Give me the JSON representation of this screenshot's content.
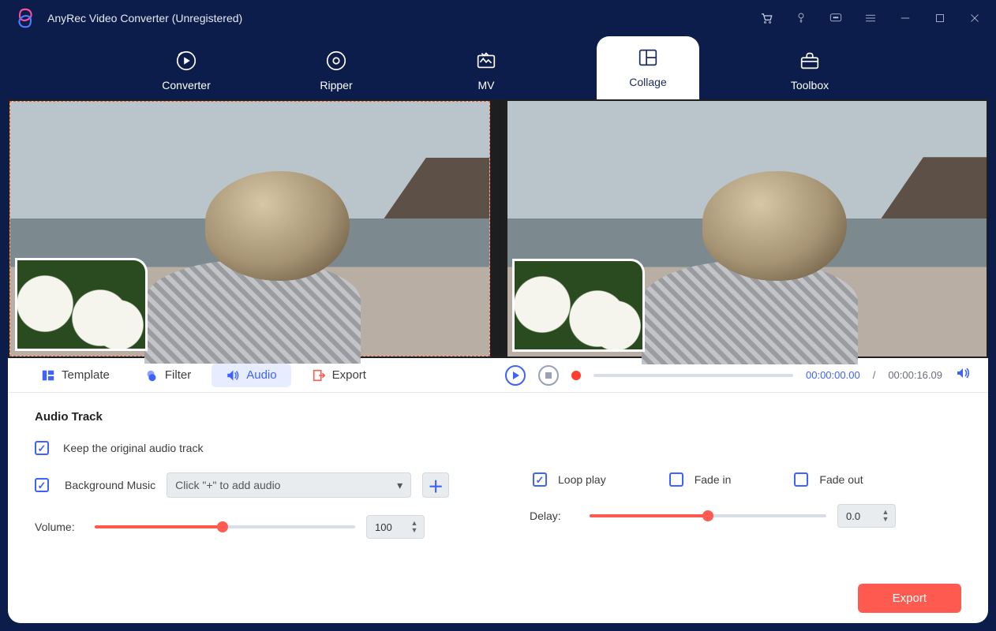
{
  "window": {
    "title": "AnyRec Video Converter (Unregistered)"
  },
  "colors": {
    "accent_blue": "#3d62ff",
    "accent_orange": "#ff5a4f",
    "header_bg": "#0c1d4c"
  },
  "mainnav": {
    "items": [
      {
        "label": "Converter",
        "icon": "converter-icon",
        "active": false
      },
      {
        "label": "Ripper",
        "icon": "ripper-icon",
        "active": false
      },
      {
        "label": "MV",
        "icon": "mv-icon",
        "active": false
      },
      {
        "label": "Collage",
        "icon": "collage-icon",
        "active": true
      },
      {
        "label": "Toolbox",
        "icon": "toolbox-icon",
        "active": false
      }
    ]
  },
  "subtabs": {
    "items": [
      {
        "label": "Template",
        "icon": "template-icon",
        "active": false
      },
      {
        "label": "Filter",
        "icon": "filter-icon",
        "active": false
      },
      {
        "label": "Audio",
        "icon": "audio-icon",
        "active": true
      },
      {
        "label": "Export",
        "icon": "export-icon",
        "active": false
      }
    ]
  },
  "playback": {
    "current": "00:00:00.00",
    "duration": "00:00:16.09",
    "separator": "/"
  },
  "audio": {
    "section_title": "Audio Track",
    "keep_original_label": "Keep the original audio track",
    "keep_original_checked": true,
    "bg_music_label": "Background Music",
    "bg_music_checked": true,
    "bg_music_placeholder": "Click \"+\" to add audio",
    "loop_label": "Loop play",
    "loop_checked": true,
    "fade_in_label": "Fade in",
    "fade_in_checked": false,
    "fade_out_label": "Fade out",
    "fade_out_checked": false,
    "volume_label": "Volume:",
    "volume_value": "100",
    "volume_percent": 49,
    "delay_label": "Delay:",
    "delay_value": "0.0",
    "delay_percent": 50
  },
  "footer": {
    "export_label": "Export"
  }
}
